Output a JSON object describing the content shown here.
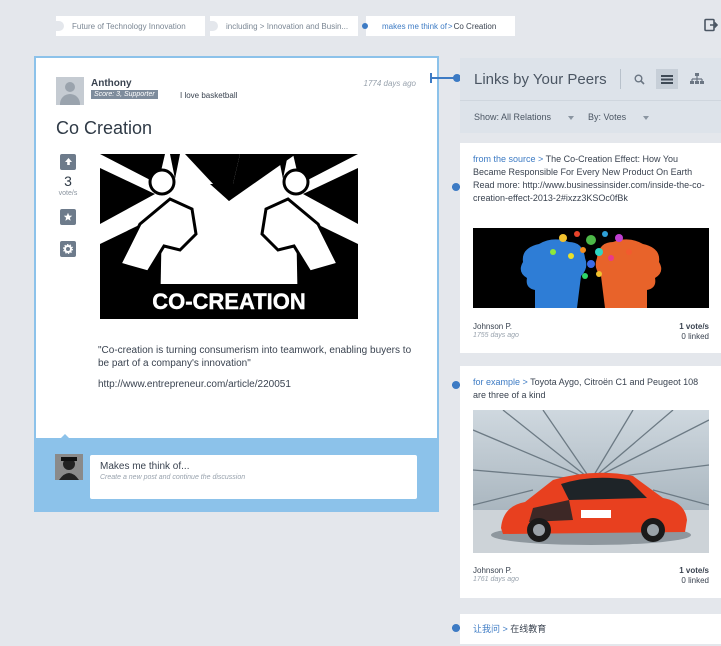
{
  "breadcrumbs": [
    {
      "label": "Future of Technology Innovation"
    },
    {
      "label": "including > Innovation and Busin..."
    },
    {
      "relation": "makes me think of",
      "label": "Co Creation"
    }
  ],
  "post": {
    "author": "Anthony",
    "score": "Score: 3, Supporter",
    "bio": "I love basketball",
    "age": "1774 days ago",
    "title": "Co Creation",
    "votes": "3",
    "vote_unit": "vote/s",
    "image_caption": "CO-CREATION",
    "quote": "\"Co-creation is turning consumerism into teamwork, enabling buyers to be part of a company's innovation\"",
    "url": "http://www.entrepreneur.com/article/220051"
  },
  "reply": {
    "title": "Makes me think of...",
    "subtitle": "Create a new post and continue the discussion"
  },
  "peers": {
    "title": "Links by Your Peers",
    "filter_relations": "Show: All Relations",
    "filter_votes": "By: Votes"
  },
  "cards": [
    {
      "relation": "from the source",
      "text": "The Co-Creation Effect: How You Became Responsible For Every New Product On Earth Read more: http://www.businessinsider.com/inside-the-co-creation-effect-2013-2#ixzz3KSOc0fBk",
      "author": "Johnson P.",
      "age": "1755 days ago",
      "votes": "1 vote/s",
      "linked": "0 linked"
    },
    {
      "relation": "for example",
      "text": "Toyota Aygo, Citroën C1 and Peugeot 108 are three of a kind",
      "author": "Johnson P.",
      "age": "1761 days ago",
      "votes": "1 vote/s",
      "linked": "0 linked"
    },
    {
      "relation": "让我问",
      "text": "在线教育"
    }
  ],
  "colors": {
    "accent": "#3d7bc4",
    "highlight_border": "#8cc2ea",
    "background": "#e4e7ec"
  }
}
